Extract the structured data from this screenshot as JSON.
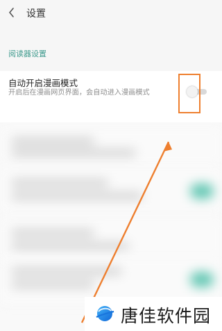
{
  "header": {
    "back_icon": "chevron-left-icon",
    "title": "设置"
  },
  "section": {
    "title": "阅读器设置"
  },
  "setting": {
    "title": "自动开启漫画模式",
    "description": "开启后在漫画网页界面，会自动进入漫画模式",
    "toggle_state": false
  },
  "annotation": {
    "highlight_color": "#ee7f2f",
    "arrow_color": "#ee7f2f"
  },
  "watermark": {
    "text": "唐佳软件园"
  },
  "colors": {
    "accent": "#3e9a8d",
    "toggle_off_track": "#d9d9d9",
    "blur_accent": "#62c7b3"
  }
}
